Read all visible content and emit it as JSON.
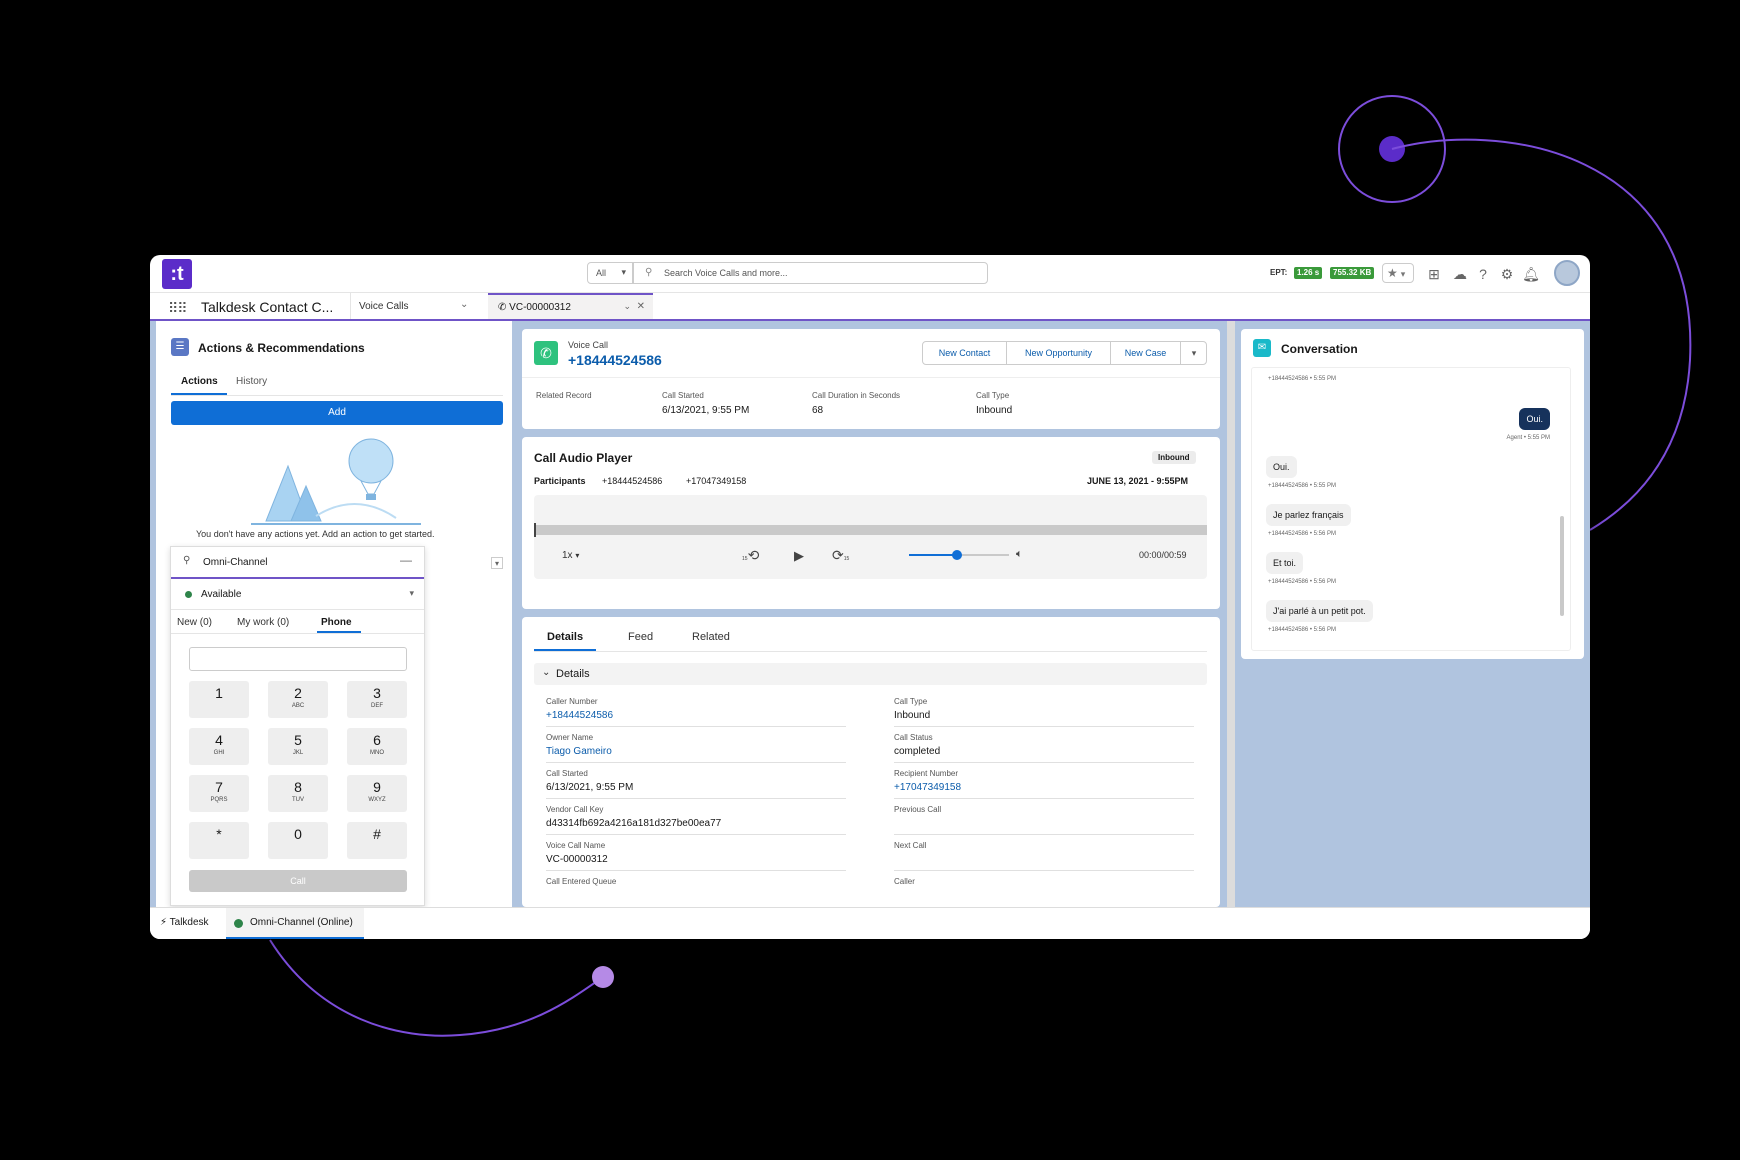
{
  "header": {
    "logo_text": ":t",
    "search_scope": "All",
    "search_placeholder": "Search Voice Calls and more...",
    "ept_label": "EPT:",
    "ept_time": "1.26 s",
    "ept_size": "755.32 KB"
  },
  "nav": {
    "app_name": "Talkdesk Contact C...",
    "object": "Voice Calls",
    "record_tab": "VC-00000312"
  },
  "actions": {
    "title": "Actions & Recommendations",
    "tabs": [
      "Actions",
      "History"
    ],
    "add_label": "Add",
    "empty_text": "You don't have any actions yet. Add an action to get started."
  },
  "omni": {
    "title": "Omni-Channel",
    "status": "Available",
    "tabs": [
      "New (0)",
      "My work (0)",
      "Phone"
    ],
    "keys": [
      {
        "d": "1",
        "l": ""
      },
      {
        "d": "2",
        "l": "ABC"
      },
      {
        "d": "3",
        "l": "DEF"
      },
      {
        "d": "4",
        "l": "GHI"
      },
      {
        "d": "5",
        "l": "JKL"
      },
      {
        "d": "6",
        "l": "MNO"
      },
      {
        "d": "7",
        "l": "PQRS"
      },
      {
        "d": "8",
        "l": "TUV"
      },
      {
        "d": "9",
        "l": "WXYZ"
      },
      {
        "d": "*",
        "l": ""
      },
      {
        "d": "0",
        "l": ""
      },
      {
        "d": "#",
        "l": ""
      }
    ],
    "call_label": "Call"
  },
  "record": {
    "type_label": "Voice Call",
    "number": "+18444524586",
    "buttons": [
      "New Contact",
      "New Opportunity",
      "New Case"
    ],
    "highlights": [
      {
        "label": "Related Record",
        "value": ""
      },
      {
        "label": "Call Started",
        "value": "6/13/2021, 9:55 PM"
      },
      {
        "label": "Call Duration in Seconds",
        "value": "68"
      },
      {
        "label": "Call Type",
        "value": "Inbound"
      }
    ]
  },
  "player": {
    "title": "Call Audio Player",
    "badge": "Inbound",
    "participants_label": "Participants",
    "participant_1": "+18444524586",
    "participant_2": "+17047349158",
    "date": "JUNE 13, 2021 - 9:55PM",
    "speed": "1x",
    "skip_back": "15",
    "skip_fwd": "15",
    "time": "00:00/00:59",
    "playback_progress": 0,
    "volume_level": 0.48
  },
  "details": {
    "tabs": [
      "Details",
      "Feed",
      "Related"
    ],
    "section": "Details",
    "left": [
      {
        "label": "Caller Number",
        "value": "+18444524586",
        "link": true
      },
      {
        "label": "Owner Name",
        "value": "Tiago Gameiro",
        "link": true
      },
      {
        "label": "Call Started",
        "value": "6/13/2021, 9:55 PM",
        "link": false
      },
      {
        "label": "Vendor Call Key",
        "value": "d43314fb692a4216a181d327be00ea77",
        "link": false
      },
      {
        "label": "Voice Call Name",
        "value": "VC-00000312",
        "link": false
      }
    ],
    "right": [
      {
        "label": "Call Type",
        "value": "Inbound",
        "link": false
      },
      {
        "label": "Call Status",
        "value": "completed",
        "link": false
      },
      {
        "label": "Recipient Number",
        "value": "+17047349158",
        "link": true
      },
      {
        "label": "Previous Call",
        "value": "",
        "link": false
      },
      {
        "label": "Next Call",
        "value": "",
        "link": false
      }
    ],
    "cut_left": "Call Entered Queue",
    "cut_right": "Caller"
  },
  "conversation": {
    "title": "Conversation",
    "messages": [
      {
        "text": "",
        "meta": "+18444524586 • 5:55 PM",
        "agent": false
      },
      {
        "text": "Oui.",
        "meta": "Agent • 5:55 PM",
        "agent": true
      },
      {
        "text": "Oui.",
        "meta": "+18444524586 • 5:55 PM",
        "agent": false
      },
      {
        "text": "Je parlez français",
        "meta": "+18444524586 • 5:56 PM",
        "agent": false
      },
      {
        "text": "Et toi.",
        "meta": "+18444524586 • 5:56 PM",
        "agent": false
      },
      {
        "text": "J'ai parlé à un petit pot.",
        "meta": "+18444524586 • 5:56 PM",
        "agent": false
      }
    ]
  },
  "footer": {
    "item1": "Talkdesk",
    "item2": "Omni-Channel (Online)"
  },
  "colors": {
    "brand": "#5b2cc9",
    "accent": "#0f6ed6",
    "workspace_bg": "#b0c4df",
    "deco_line": "#7c4ddb"
  }
}
